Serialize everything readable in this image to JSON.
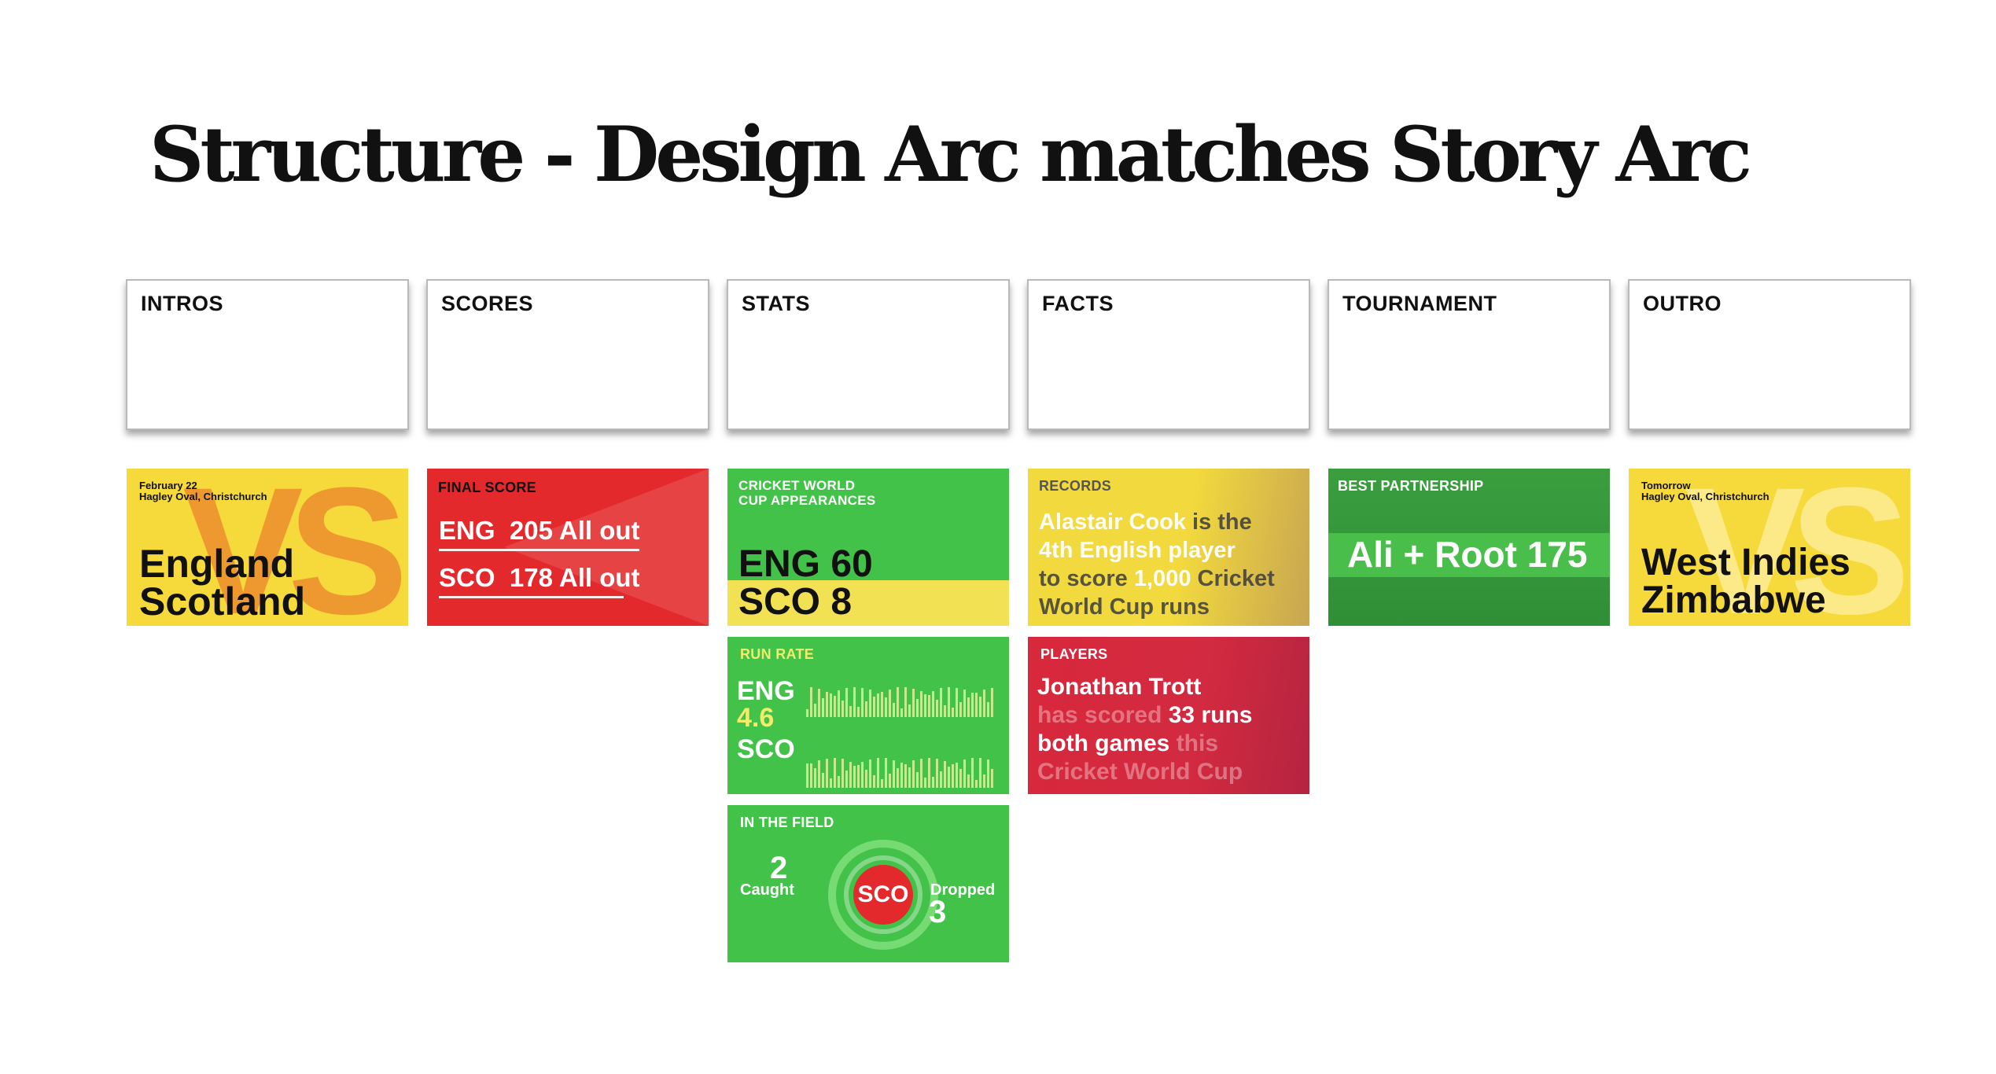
{
  "title": "Structure - Design Arc matches Story Arc",
  "columns": [
    "INTROS",
    "SCORES",
    "STATS",
    "FACTS",
    "TOURNAMENT",
    "OUTRO"
  ],
  "cards": {
    "intro": {
      "date": "February 22",
      "venue": "Hagley Oval, Christchurch",
      "vs": "VS",
      "team1": "England",
      "team2": "Scotland"
    },
    "final_score": {
      "tag": "FINAL SCORE",
      "line1_team": "ENG",
      "line1_score": "205 All out",
      "line2_team": "SCO",
      "line2_score": "178 All out"
    },
    "appearances": {
      "tag1": "CRICKET WORLD",
      "tag2": "CUP APPEARANCES",
      "line1": "ENG 60",
      "line2": "SCO 8"
    },
    "run_rate": {
      "tag": "RUN RATE",
      "team1": "ENG",
      "rate": "4.6",
      "team2": "SCO"
    },
    "in_field": {
      "tag": "IN THE FIELD",
      "caught_num": "2",
      "caught_label": "Caught",
      "team": "SCO",
      "dropped_label": "Dropped",
      "dropped_num": "3"
    },
    "records": {
      "tag": "RECORDS",
      "l1a": "Alastair Cook",
      "l1b": " is the",
      "l2": "4th English player",
      "l3a": "to score ",
      "l3b": "1,000",
      "l3c": " Cricket",
      "l4": "World Cup runs"
    },
    "players": {
      "tag": "PLAYERS",
      "l1": "Jonathan Trott",
      "l2a": "has scored ",
      "l2b": "33 runs",
      "l3a": "both games",
      "l3b": " this",
      "l4": "Cricket World Cup"
    },
    "partnership": {
      "tag": "BEST PARTNERSHIP",
      "text": "Ali + Root 175"
    },
    "outro": {
      "date": "Tomorrow",
      "venue": "Hagley Oval, Christchurch",
      "vs": "VS",
      "team1": "West Indies",
      "team2": "Zimbabwe"
    }
  }
}
